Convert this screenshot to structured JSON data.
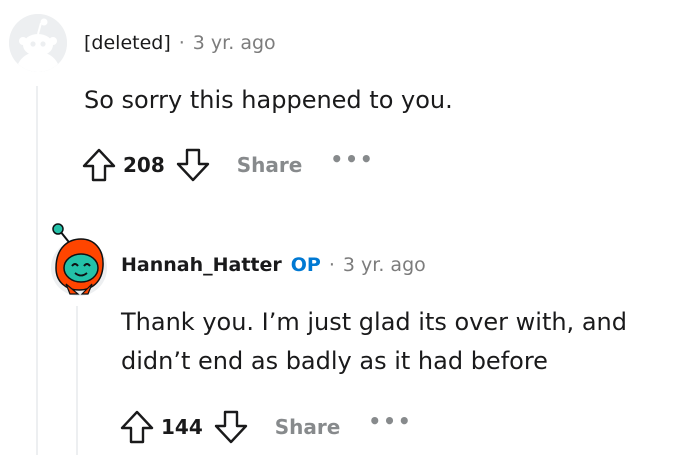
{
  "comment_top": {
    "author": "[deleted]",
    "separator": "·",
    "time": "3 yr. ago",
    "body": "So sorry this happened to you.",
    "score": "208",
    "share_label": "Share",
    "more_label": "•••",
    "avatar_icon": "snoo-default-avatar-icon"
  },
  "comment_reply": {
    "author": "Hannah_Hatter",
    "op_badge": "OP",
    "separator": "·",
    "time": "3 yr. ago",
    "body_line1": "Thank you. I’m just glad its over with, and",
    "body_line2": "didn’t end as badly as it had before",
    "score": "144",
    "share_label": "Share",
    "more_label": "•••",
    "avatar_icon": "snoo-orange-hood-avatar-icon"
  },
  "colors": {
    "op_badge": "#0079d3",
    "meta_text": "#7c7c7c",
    "action_text": "#878a8c",
    "thread_line": "#edeff1",
    "avatar_orange": "#ff4500",
    "avatar_teal": "#24c1a8"
  }
}
